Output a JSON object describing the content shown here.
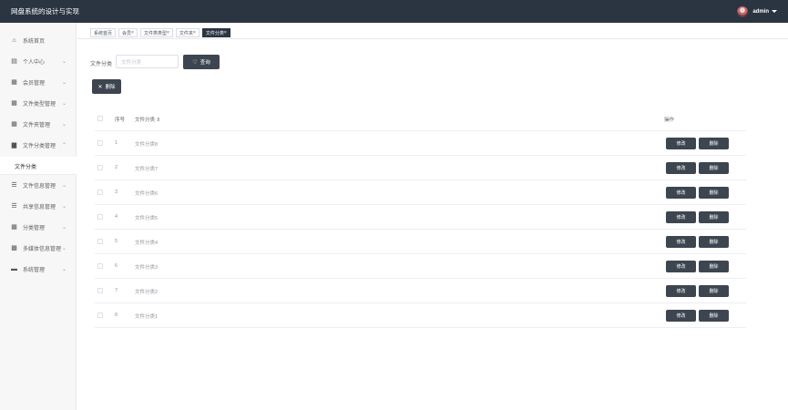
{
  "header": {
    "title": "网盘系统的设计与实现",
    "user": "admin"
  },
  "sidebar": {
    "items": [
      {
        "label": "系统首页",
        "icon": "home-icon",
        "glyph": "⌂",
        "arrow": ""
      },
      {
        "label": "个人中心",
        "icon": "calendar-icon",
        "glyph": "▤",
        "arrow": "⌄"
      },
      {
        "label": "会员管理",
        "icon": "grid-icon",
        "glyph": "▦",
        "arrow": "⌄"
      },
      {
        "label": "文件类型管理",
        "icon": "grid-icon",
        "glyph": "▦",
        "arrow": "⌄"
      },
      {
        "label": "文件夹管理",
        "icon": "grid-icon",
        "glyph": "▦",
        "arrow": "⌄"
      },
      {
        "label": "文件分类管理",
        "icon": "clipboard-icon",
        "glyph": "▆",
        "arrow": "⌃"
      },
      {
        "label": "文件信息管理",
        "icon": "list-icon",
        "glyph": "☰",
        "arrow": "⌄"
      },
      {
        "label": "共享信息管理",
        "icon": "list-icon",
        "glyph": "☰",
        "arrow": "⌄"
      },
      {
        "label": "分类管理",
        "icon": "grid-icon",
        "glyph": "▦",
        "arrow": "⌄"
      },
      {
        "label": "多媒体信息管理",
        "icon": "apps-icon",
        "glyph": "▩",
        "arrow": "⌄"
      },
      {
        "label": "系统管理",
        "icon": "monitor-icon",
        "glyph": "▬",
        "arrow": "⌄"
      }
    ],
    "submenu": {
      "label": "文件分类"
    }
  },
  "tabs": [
    {
      "label": "系统首页",
      "close": ""
    },
    {
      "label": "会员",
      "close": "×"
    },
    {
      "label": "文件类类型",
      "close": "×"
    },
    {
      "label": "文件夹",
      "close": "×"
    },
    {
      "label": "文件分类",
      "close": "×",
      "active": true
    }
  ],
  "filter": {
    "label": "文件分类",
    "placeholder": "文件分类",
    "search_label": "查询",
    "delete_label": "删除"
  },
  "table": {
    "headers": {
      "index": "序号",
      "name": "文件分类 ⇕",
      "ops": "操作"
    },
    "rows": [
      {
        "index": "1",
        "name": "文件分类8"
      },
      {
        "index": "2",
        "name": "文件分类7"
      },
      {
        "index": "3",
        "name": "文件分类6"
      },
      {
        "index": "4",
        "name": "文件分类5"
      },
      {
        "index": "5",
        "name": "文件分类4"
      },
      {
        "index": "6",
        "name": "文件分类3"
      },
      {
        "index": "7",
        "name": "文件分类2"
      },
      {
        "index": "8",
        "name": "文件分类1"
      }
    ],
    "edit_label": "修改",
    "delete_label": "删除"
  },
  "colors": {
    "header_bg": "#2b3441",
    "button_bg": "#3d4550",
    "sidebar_bg": "#f7f7f7"
  }
}
